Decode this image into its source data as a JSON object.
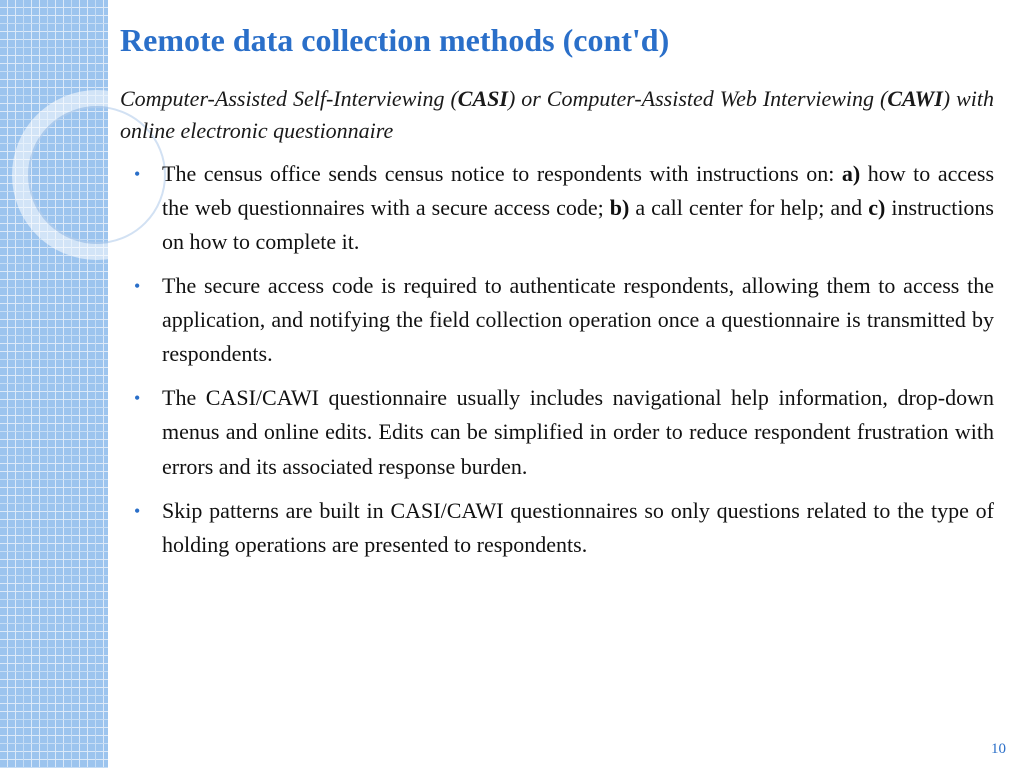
{
  "title": "Remote data collection methods (cont'd)",
  "intro": {
    "p1a": "Computer-Assisted Self-Interviewing (",
    "acr1": "CASI",
    "p1b": ") or Computer-Assisted Web Interviewing (",
    "acr2": "CAWI",
    "p1c": ") with online electronic questionnaire"
  },
  "bullets": [
    {
      "pre": "The census office sends census notice to respondents with instructions on: ",
      "a_label": "a)",
      "a_text": " how to access the web questionnaires with a secure access code; ",
      "b_label": "b)",
      "b_text": " a call center for help; and ",
      "c_label": "c)",
      "c_text": " instructions on how to complete it."
    },
    {
      "text": "The secure access code is required to authenticate respondents, allowing them to access the application, and notifying the field collection operation once a questionnaire is transmitted by respondents."
    },
    {
      "text": "The CASI/CAWI questionnaire usually includes navigational help information, drop-down menus and online edits. Edits can be simplified in order to reduce respondent frustration with errors and its associated response burden."
    },
    {
      "text": "Skip patterns are built in CASI/CAWI questionnaires so only questions related to the type of holding operations are presented to respondents."
    }
  ],
  "page_number": "10"
}
